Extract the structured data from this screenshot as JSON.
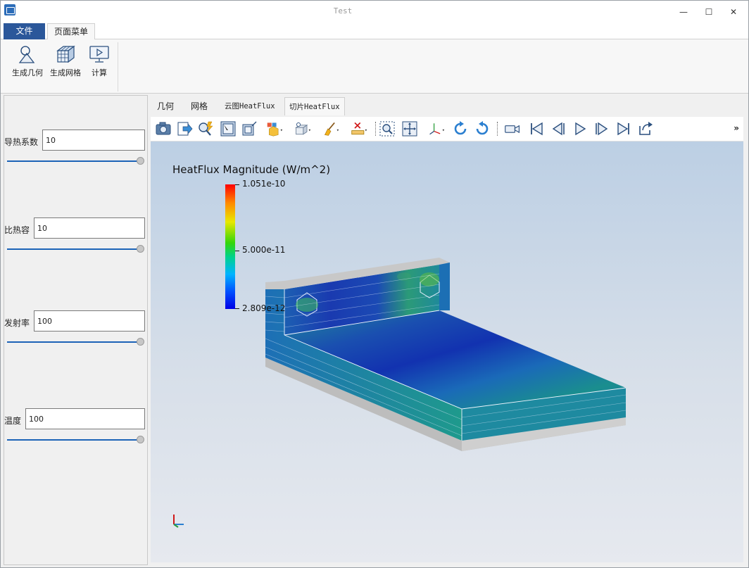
{
  "window": {
    "title": "Test",
    "controls": {
      "minimize": "—",
      "maximize": "☐",
      "close": "✕"
    }
  },
  "ribbon": {
    "tabs": [
      {
        "label": "文件"
      },
      {
        "label": "页面菜单"
      }
    ],
    "buttons": [
      {
        "label": "生成几何",
        "icon": "geometry-icon"
      },
      {
        "label": "生成网格",
        "icon": "mesh-icon"
      },
      {
        "label": "计算",
        "icon": "compute-icon"
      }
    ]
  },
  "params": [
    {
      "label": "导热系数",
      "value": "10",
      "slider": 1.0
    },
    {
      "label": "比热容",
      "value": "10",
      "slider": 1.0
    },
    {
      "label": "发射率",
      "value": "100",
      "slider": 1.0
    },
    {
      "label": "温度",
      "value": "100",
      "slider": 1.0
    }
  ],
  "viewer": {
    "tabs": [
      {
        "label": "几何",
        "active": false
      },
      {
        "label": "网格",
        "active": false
      },
      {
        "label": "云图HeatFlux",
        "active": false
      },
      {
        "label": "切片HeatFlux",
        "active": true
      }
    ],
    "toolbar_overflow": "»",
    "toolbar_icons": [
      "camera-icon",
      "export-icon",
      "query-icon",
      "select-surface-icon",
      "select-box-icon",
      "color-map-icon",
      "display-mode-icon",
      "clear-brush-icon",
      "ruler-delete-icon",
      "zoom-to-box-icon",
      "reset-view-icon",
      "axes-orient-icon",
      "rotate-cw-icon",
      "rotate-ccw-icon",
      "record-video-icon",
      "first-frame-icon",
      "prev-frame-icon",
      "play-icon",
      "next-frame-icon",
      "last-frame-icon",
      "loop-icon"
    ]
  },
  "legend": {
    "title": "HeatFlux Magnitude (W/m^2)",
    "max": "1.051e-10",
    "mid": "5.000e-11",
    "min": "2.809e-12"
  },
  "colors": {
    "accent": "#2b579a",
    "slider": "#1c63b7"
  }
}
